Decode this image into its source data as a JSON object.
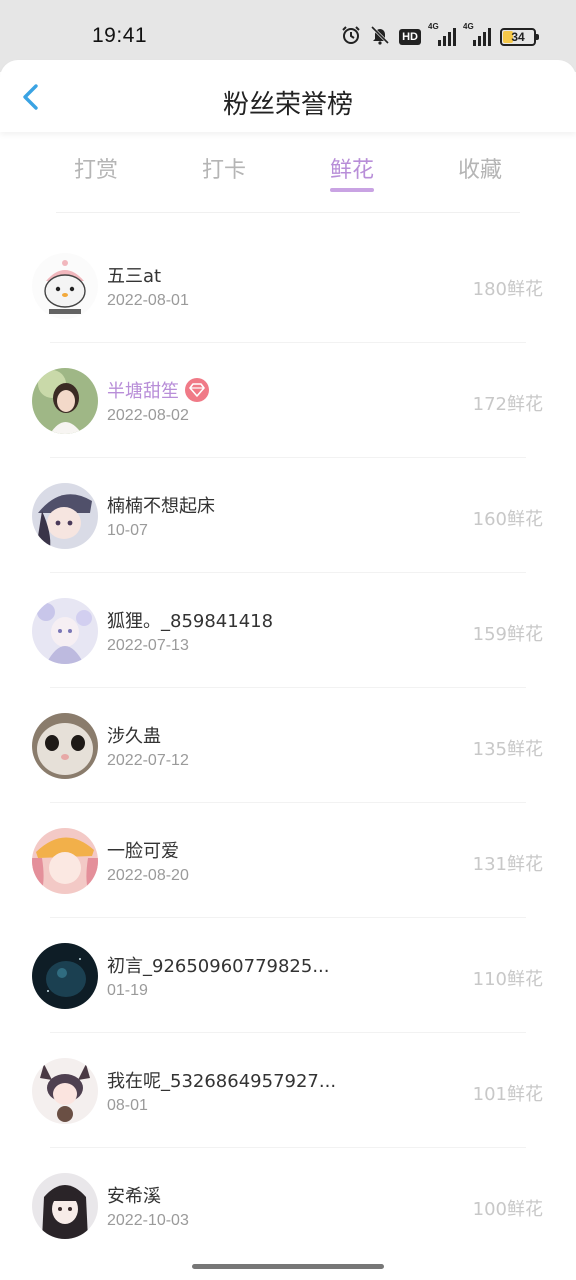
{
  "status_bar": {
    "time": "19:41",
    "hd_label": "HD",
    "signal_label_1": "4G",
    "signal_label_2": "4G",
    "battery_level": "34",
    "battery_fill_color": "#f5c84a",
    "icons": [
      "alarm-icon",
      "mute-icon",
      "hd-icon",
      "signal-icon",
      "signal-icon",
      "battery-icon"
    ]
  },
  "header": {
    "title": "粉丝荣誉榜",
    "back_icon": "chevron-left-icon",
    "back_color": "#3aa3e3"
  },
  "tabs": [
    {
      "label": "打赏",
      "active": false
    },
    {
      "label": "打卡",
      "active": false
    },
    {
      "label": "鲜花",
      "active": true
    },
    {
      "label": "收藏",
      "active": false
    }
  ],
  "colors": {
    "accent": "#b88ed8",
    "badge": "#f07a87",
    "amount": "#c8c8c8"
  },
  "fans": [
    {
      "name": "五三at",
      "date": "2022-08-01",
      "amount": "180鲜花",
      "vip": false
    },
    {
      "name": "半塘甜笙",
      "date": "2022-08-02",
      "amount": "172鲜花",
      "vip": true
    },
    {
      "name": "楠楠不想起床",
      "date": "10-07",
      "amount": "160鲜花",
      "vip": false
    },
    {
      "name": "狐狸。_859841418",
      "date": "2022-07-13",
      "amount": "159鲜花",
      "vip": false
    },
    {
      "name": "涉久蛊",
      "date": "2022-07-12",
      "amount": "135鲜花",
      "vip": false
    },
    {
      "name": "一脸可爱",
      "date": "2022-08-20",
      "amount": "131鲜花",
      "vip": false
    },
    {
      "name": "初言_92650960779825...",
      "date": "01-19",
      "amount": "110鲜花",
      "vip": false
    },
    {
      "name": "我在呢_5326864957927...",
      "date": "08-01",
      "amount": "101鲜花",
      "vip": false
    },
    {
      "name": "安希溪",
      "date": "2022-10-03",
      "amount": "100鲜花",
      "vip": false
    }
  ]
}
